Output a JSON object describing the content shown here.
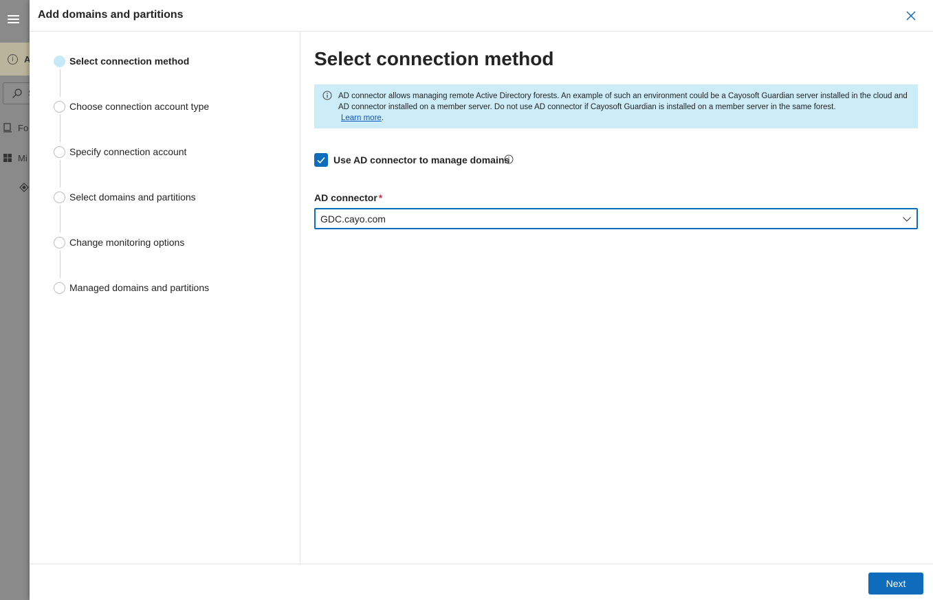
{
  "background": {
    "banner_text": "A",
    "search_text": "S",
    "nav_items": [
      "Fo",
      "Mi"
    ]
  },
  "dialog": {
    "title": "Add domains and partitions",
    "close_label": "Close"
  },
  "steps": [
    {
      "label": "Select connection method",
      "state": "active"
    },
    {
      "label": "Choose connection account type",
      "state": "pending"
    },
    {
      "label": "Specify connection account",
      "state": "pending"
    },
    {
      "label": "Select domains and partitions",
      "state": "pending"
    },
    {
      "label": "Change monitoring options",
      "state": "pending"
    },
    {
      "label": "Managed domains and partitions",
      "state": "pending"
    }
  ],
  "main": {
    "title": "Select connection method",
    "info": {
      "text": "AD connector allows managing remote Active Directory forests. An example of such an environment could be a Cayosoft Guardian server installed in the cloud and AD connector installed on a member server. Do not use AD connector if Cayosoft Guardian is installed on a member server in the same forest.",
      "link_text": "Learn more",
      "trailing": "."
    },
    "checkbox": {
      "label": "Use AD connector to manage domains",
      "checked": true
    },
    "connector_field": {
      "label": "AD connector",
      "required_mark": "*",
      "value": "GDC.cayo.com"
    }
  },
  "footer": {
    "next_label": "Next"
  },
  "colors": {
    "accent": "#0f6cbd",
    "info_bg": "#ccecf7",
    "active_step": "#c7e9f7",
    "required": "#c4314b"
  }
}
